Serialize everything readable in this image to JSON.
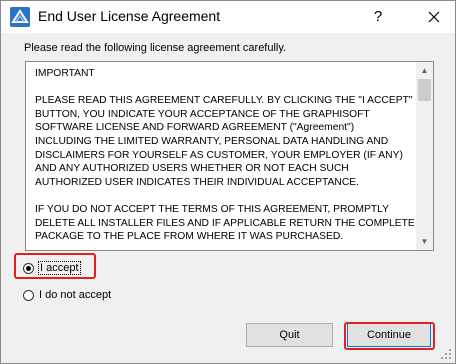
{
  "window": {
    "title": "End User License Agreement",
    "help_label": "?",
    "app_icon": "graphisoft-archicad-icon",
    "close_icon": "close-icon"
  },
  "instruction": "Please read the following license agreement carefully.",
  "license": {
    "heading": "IMPORTANT",
    "paragraph1_lines": [
      "PLEASE READ THIS AGREEMENT CAREFULLY. BY CLICKING THE \"I ACCEPT\"",
      "BUTTON, YOU INDICATE YOUR ACCEPTANCE OF THE GRAPHISOFT",
      "SOFTWARE LICENSE AND FORWARD AGREEMENT (\"Agreement\")",
      "INCLUDING THE LIMITED WARRANTY, PERSONAL DATA HANDLING AND",
      "DISCLAIMERS FOR YOURSELF AS CUSTOMER, YOUR EMPLOYER (IF ANY)",
      "AND ANY AUTHORIZED USERS WHETHER OR NOT EACH SUCH",
      "AUTHORIZED USER INDICATES THEIR INDIVIDUAL ACCEPTANCE."
    ],
    "paragraph2_lines": [
      "IF YOU DO NOT ACCEPT THE TERMS OF THIS AGREEMENT, PROMPTLY",
      "DELETE ALL INSTALLER FILES AND IF APPLICABLE RETURN THE COMPLETE",
      "PACKAGE TO THE PLACE FROM WHERE IT WAS PURCHASED."
    ]
  },
  "options": {
    "accept_label": "I accept",
    "decline_label": "I do not accept",
    "selected": "accept"
  },
  "buttons": {
    "quit_label": "Quit",
    "continue_label": "Continue"
  },
  "colors": {
    "highlight": "#e02020",
    "default_button_border": "#0078d7"
  }
}
